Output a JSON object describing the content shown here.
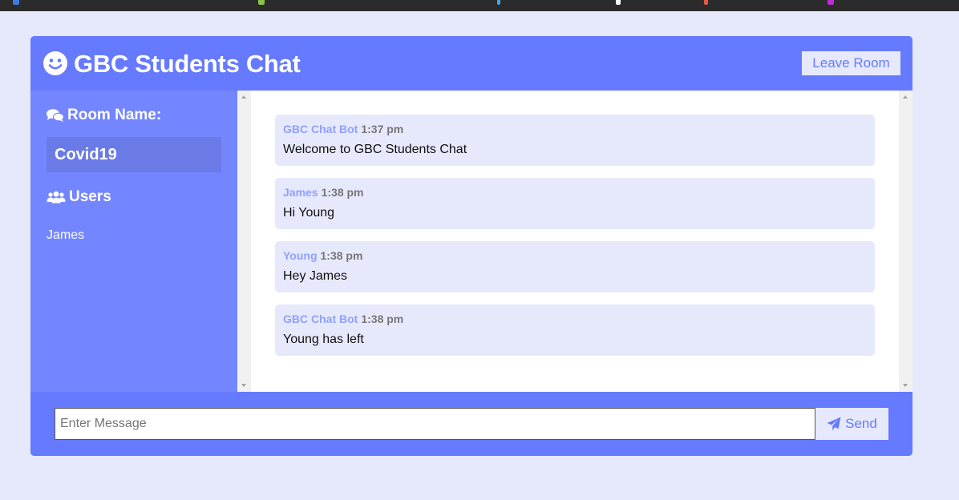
{
  "colors": {
    "page_bg": "#e6e9fb",
    "header_bg": "#667aff",
    "sidebar_bg": "#7386ff",
    "room_box_bg": "#6a7ae6",
    "message_bg": "#e6e9fb",
    "sender_color": "#8fa0ff"
  },
  "header": {
    "icon": "smile-icon",
    "title": "GBC Students Chat",
    "leave_label": "Leave Room"
  },
  "sidebar": {
    "room_heading": "Room Name:",
    "room_heading_icon": "comments-icon",
    "room_name": "Covid19",
    "users_heading": "Users",
    "users_heading_icon": "users-icon",
    "users": [
      "James"
    ]
  },
  "messages": [
    {
      "sender": "GBC Chat Bot",
      "time": "1:37 pm",
      "text": "Welcome to GBC Students Chat"
    },
    {
      "sender": "James",
      "time": "1:38 pm",
      "text": "Hi Young"
    },
    {
      "sender": "Young",
      "time": "1:38 pm",
      "text": "Hey James"
    },
    {
      "sender": "GBC Chat Bot",
      "time": "1:38 pm",
      "text": "Young has left"
    }
  ],
  "form": {
    "placeholder": "Enter Message",
    "send_label": "Send",
    "send_icon": "paper-plane-icon"
  }
}
